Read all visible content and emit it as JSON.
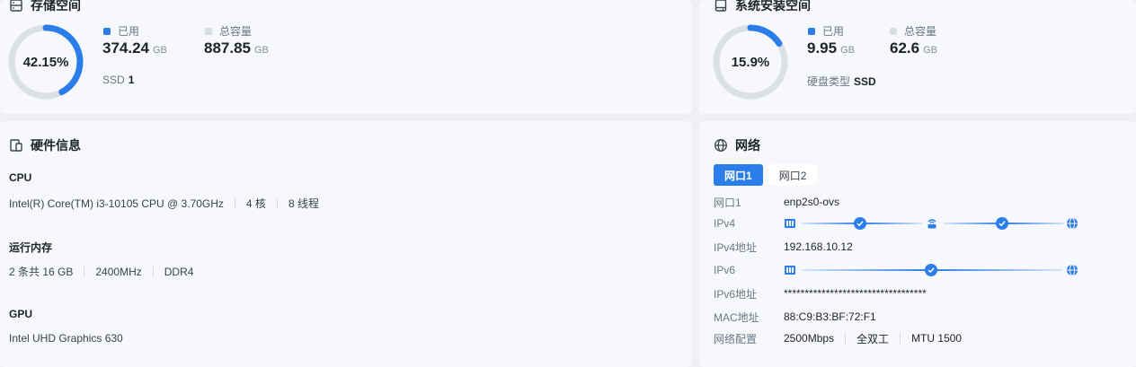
{
  "storage": {
    "title": "存储空间",
    "percent_label": "42.15%",
    "percent": 42.15,
    "used_label": "已用",
    "used_value": "374.24",
    "used_unit": "GB",
    "total_label": "总容量",
    "total_value": "887.85",
    "total_unit": "GB",
    "disk_type_label": "SSD",
    "disk_type_value": "1"
  },
  "system": {
    "title": "系统安装空间",
    "percent_label": "15.9%",
    "percent": 15.9,
    "used_label": "已用",
    "used_value": "9.95",
    "used_unit": "GB",
    "total_label": "总容量",
    "total_value": "62.6",
    "total_unit": "GB",
    "disk_type_label": "硬盘类型",
    "disk_type_value": "SSD"
  },
  "hardware": {
    "title": "硬件信息",
    "cpu_label": "CPU",
    "cpu_model": "Intel(R) Core(TM) i3-10105 CPU @ 3.70GHz",
    "cpu_cores": "4 核",
    "cpu_threads": "8 线程",
    "mem_label": "运行内存",
    "mem_size": "2 条共 16 GB",
    "mem_speed": "2400MHz",
    "mem_type": "DDR4",
    "gpu_label": "GPU",
    "gpu_model": "Intel UHD Graphics 630"
  },
  "network": {
    "title": "网络",
    "tabs": [
      "网口1",
      "网口2"
    ],
    "active_tab": 0,
    "port_label": "网口1",
    "port_value": "enp2s0-ovs",
    "ipv4_label": "IPv4",
    "ipv4_addr_label": "IPv4地址",
    "ipv4_addr_value": "192.168.10.12",
    "ipv6_label": "IPv6",
    "ipv6_addr_label": "IPv6地址",
    "ipv6_addr_value": "**********************************",
    "mac_label": "MAC地址",
    "mac_value": "88:C9:B3:BF:72:F1",
    "config_label": "网络配置",
    "config_speed": "2500Mbps",
    "config_duplex": "全双工",
    "config_mtu": "MTU 1500"
  },
  "colors": {
    "accent": "#2b7de9",
    "ring_track": "#dcdfe6",
    "total_dot": "#d9dce1"
  },
  "icons": [
    "storage-icon",
    "system-disk-icon",
    "hardware-icon",
    "globe-icon",
    "nic-icon",
    "router-icon",
    "internet-icon",
    "check-icon"
  ]
}
